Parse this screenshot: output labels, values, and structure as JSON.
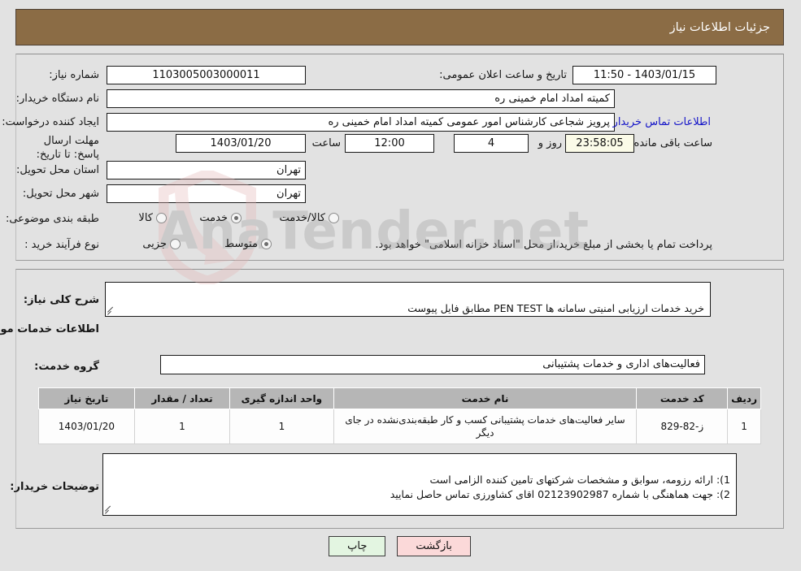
{
  "header": {
    "title": "جزئیات اطلاعات نیاز",
    "bg_color": "#8b6c45"
  },
  "watermark": {
    "text": "AnaTender.net"
  },
  "top_panel": {
    "need_number": {
      "label": "شماره نیاز:",
      "value": "1103005003000011"
    },
    "public_announce": {
      "label": "تاریخ و ساعت اعلان عمومی:",
      "value": "1403/01/15 - 11:50"
    },
    "buyer_org": {
      "label": "نام دستگاه خریدار:",
      "value": "کمیته امداد امام خمینی ره"
    },
    "request_creator": {
      "label": "ایجاد کننده درخواست:",
      "value": "پرویز شجاعی کارشناس امور عمومی کمیته امداد امام خمینی ره"
    },
    "contact_link": {
      "label": "اطلاعات تماس خریدار",
      "color": "#1414c8"
    },
    "deadline": {
      "label": "مهلت ارسال پاسخ: تا تاریخ:",
      "date": "1403/01/20",
      "time_label": "ساعت",
      "time": "12:00",
      "days": "4",
      "days_label": "روز و",
      "countdown": "23:58:05",
      "countdown_label": "ساعت باقی مانده"
    },
    "delivery_province": {
      "label": "استان محل تحویل:",
      "value": "تهران"
    },
    "delivery_city": {
      "label": "شهر محل تحویل:",
      "value": "تهران"
    },
    "category": {
      "label": "طبقه بندی موضوعی:",
      "options": [
        "کالا",
        "خدمت",
        "کالا/خدمت"
      ],
      "selected": "خدمت"
    },
    "purchase_process": {
      "label": "نوع فرآیند خرید :",
      "options": [
        "جزیی",
        "متوسط"
      ],
      "selected": "متوسط",
      "note": "پرداخت تمام یا بخشی از مبلغ خرید،از محل \"اسناد خزانه اسلامی\" خواهد بود."
    }
  },
  "middle_panel": {
    "need_summary": {
      "label": "شرح کلی نیاز:",
      "value": "خرید خدمات ارزیابی امنیتی سامانه ها PEN TEST مطابق فایل پیوست"
    },
    "services_section_title": "اطلاعات خدمات مورد نیاز",
    "service_group": {
      "label": "گروه خدمت:",
      "value": "فعالیت‌های اداری و خدمات پشتیبانی"
    },
    "table": {
      "columns": [
        "ردیف",
        "کد خدمت",
        "نام خدمت",
        "واحد اندازه گیری",
        "تعداد / مقدار",
        "تاریخ نیاز"
      ],
      "rows": [
        {
          "row_no": "1",
          "service_code": "ز-82-829",
          "service_name": "سایر فعالیت‌های خدمات پشتیبانی کسب و کار طبقه‌بندی‌نشده در جای دیگر",
          "unit": "1",
          "quantity": "1",
          "need_date": "1403/01/20"
        }
      ]
    },
    "buyer_notes": {
      "label": "توضیحات خریدار:",
      "value": "1): ارائه رزومه، سوابق و مشخصات شرکتهای تامین کننده الزامی است\n2): جهت هماهنگی با شماره 02123902987 اقای کشاورزی تماس حاصل نمایید"
    }
  },
  "buttons": {
    "print": {
      "label": "چاپ",
      "color": "#e3f5e1"
    },
    "back": {
      "label": "بازگشت",
      "color": "#fbd9d9"
    }
  }
}
